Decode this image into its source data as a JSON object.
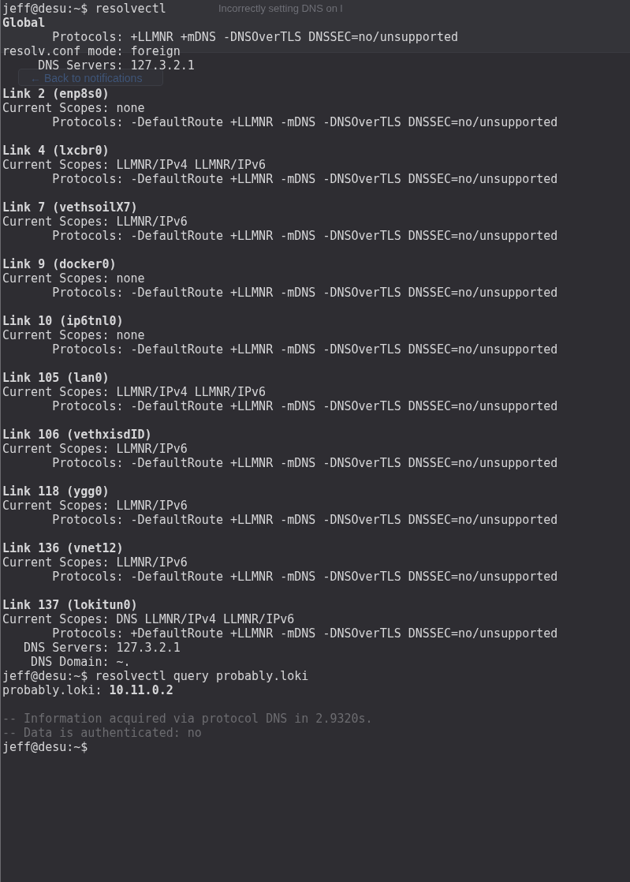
{
  "background_window": {
    "tab_title": "Incorrectly setting DNS on l",
    "back_button": "← Back to notifications"
  },
  "terminal": {
    "blocks": [
      [
        {
          "kind": "plain",
          "text": "jeff@desu:~$ resolvectl"
        },
        {
          "kind": "heading",
          "text": "Global"
        },
        {
          "kind": "plain",
          "text": "       Protocols: +LLMNR +mDNS -DNSOverTLS DNSSEC=no/unsupported"
        },
        {
          "kind": "plain",
          "text": "resolv.conf mode: foreign"
        },
        {
          "kind": "plain",
          "text": "     DNS Servers: 127.3.2.1"
        }
      ],
      [
        {
          "kind": "heading",
          "text": "Link 2 (enp8s0)"
        },
        {
          "kind": "plain",
          "text": "Current Scopes: none"
        },
        {
          "kind": "plain",
          "text": "       Protocols: -DefaultRoute +LLMNR -mDNS -DNSOverTLS DNSSEC=no/unsupported"
        }
      ],
      [
        {
          "kind": "heading",
          "text": "Link 4 (lxcbr0)"
        },
        {
          "kind": "plain",
          "text": "Current Scopes: LLMNR/IPv4 LLMNR/IPv6"
        },
        {
          "kind": "plain",
          "text": "       Protocols: -DefaultRoute +LLMNR -mDNS -DNSOverTLS DNSSEC=no/unsupported"
        }
      ],
      [
        {
          "kind": "heading",
          "text": "Link 7 (vethsoilX7)"
        },
        {
          "kind": "plain",
          "text": "Current Scopes: LLMNR/IPv6"
        },
        {
          "kind": "plain",
          "text": "       Protocols: -DefaultRoute +LLMNR -mDNS -DNSOverTLS DNSSEC=no/unsupported"
        }
      ],
      [
        {
          "kind": "heading",
          "text": "Link 9 (docker0)"
        },
        {
          "kind": "plain",
          "text": "Current Scopes: none"
        },
        {
          "kind": "plain",
          "text": "       Protocols: -DefaultRoute +LLMNR -mDNS -DNSOverTLS DNSSEC=no/unsupported"
        }
      ],
      [
        {
          "kind": "heading",
          "text": "Link 10 (ip6tnl0)"
        },
        {
          "kind": "plain",
          "text": "Current Scopes: none"
        },
        {
          "kind": "plain",
          "text": "       Protocols: -DefaultRoute +LLMNR -mDNS -DNSOverTLS DNSSEC=no/unsupported"
        }
      ],
      [
        {
          "kind": "heading",
          "text": "Link 105 (lan0)"
        },
        {
          "kind": "plain",
          "text": "Current Scopes: LLMNR/IPv4 LLMNR/IPv6"
        },
        {
          "kind": "plain",
          "text": "       Protocols: -DefaultRoute +LLMNR -mDNS -DNSOverTLS DNSSEC=no/unsupported"
        }
      ],
      [
        {
          "kind": "heading",
          "text": "Link 106 (vethxisdID)"
        },
        {
          "kind": "plain",
          "text": "Current Scopes: LLMNR/IPv6"
        },
        {
          "kind": "plain",
          "text": "       Protocols: -DefaultRoute +LLMNR -mDNS -DNSOverTLS DNSSEC=no/unsupported"
        }
      ],
      [
        {
          "kind": "heading",
          "text": "Link 118 (ygg0)"
        },
        {
          "kind": "plain",
          "text": "Current Scopes: LLMNR/IPv6"
        },
        {
          "kind": "plain",
          "text": "       Protocols: -DefaultRoute +LLMNR -mDNS -DNSOverTLS DNSSEC=no/unsupported"
        }
      ],
      [
        {
          "kind": "heading",
          "text": "Link 136 (vnet12)"
        },
        {
          "kind": "plain",
          "text": "Current Scopes: LLMNR/IPv6"
        },
        {
          "kind": "plain",
          "text": "       Protocols: -DefaultRoute +LLMNR -mDNS -DNSOverTLS DNSSEC=no/unsupported"
        }
      ],
      [
        {
          "kind": "heading",
          "text": "Link 137 (lokitun0)"
        },
        {
          "kind": "plain",
          "text": "Current Scopes: DNS LLMNR/IPv4 LLMNR/IPv6"
        },
        {
          "kind": "plain",
          "text": "       Protocols: +DefaultRoute +LLMNR -mDNS -DNSOverTLS DNSSEC=no/unsupported"
        },
        {
          "kind": "plain",
          "text": "   DNS Servers: 127.3.2.1"
        },
        {
          "kind": "plain",
          "text": "    DNS Domain: ~."
        },
        {
          "kind": "plain",
          "text": "jeff@desu:~$ resolvectl query probably.loki"
        },
        {
          "kind": "plain",
          "text": "probably.loki: **10.11.0.2**"
        }
      ],
      [
        {
          "kind": "comment",
          "text": "-- Information acquired via protocol DNS in 2.9320s."
        },
        {
          "kind": "comment",
          "text": "-- Data is authenticated: no"
        },
        {
          "kind": "plain",
          "text": "jeff@desu:~$"
        }
      ]
    ]
  }
}
